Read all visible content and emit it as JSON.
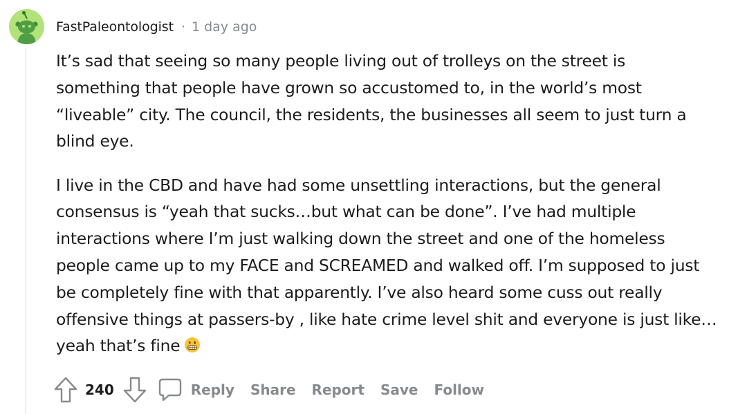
{
  "comment": {
    "author": "FastPaleontologist",
    "separator": "·",
    "time_ago": "1 day ago",
    "paragraphs": [
      [
        "It’s sad that seeing so many people living out of trolleys on the street is",
        "something that people have grown so accustomed to, in the world’s most",
        "“liveable” city. The council, the residents, the businesses all seem to just turn a",
        "blind eye."
      ],
      [
        "I live in the CBD and have had some unsettling interactions, but the general",
        "consensus is “yeah that sucks…but what can be done”. I’ve had multiple",
        "interactions where I’m just walking down the street and one of the homeless",
        "people came up to my FACE and SCREAMED and walked off. I’m supposed to just",
        "be completely fine with that apparently. I’ve also heard some cuss out really",
        "offensive things at passers-by , like hate crime level shit and everyone is just like…",
        "yeah that’s fine"
      ]
    ],
    "emoji": "grimacing-face-icon"
  },
  "actions": {
    "score": "240",
    "reply_label": "Reply",
    "share_label": "Share",
    "report_label": "Report",
    "save_label": "Save",
    "follow_label": "Follow"
  },
  "colors": {
    "text": "#1c1c1c",
    "meta": "#878a8c",
    "avatar_bg": "#b4e27a",
    "thread_line": "#edeff1"
  }
}
